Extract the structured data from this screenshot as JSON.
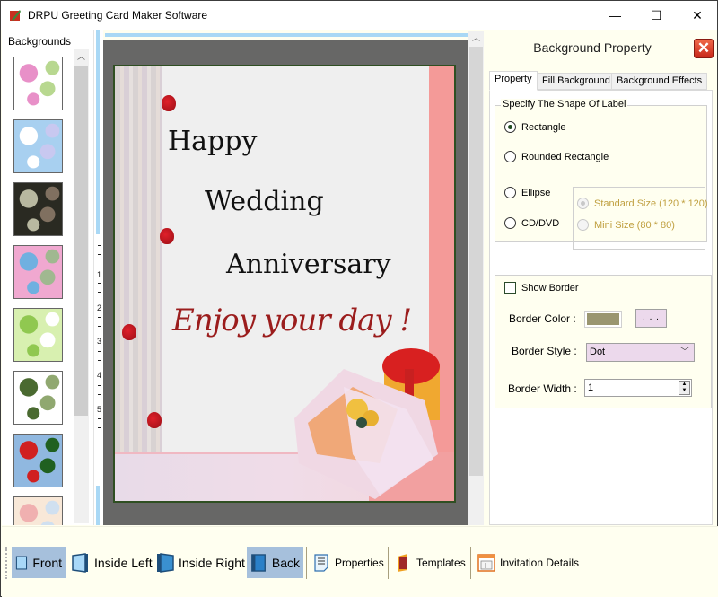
{
  "window": {
    "title": "DRPU Greeting Card Maker Software",
    "controls": {
      "minimize": "—",
      "maximize": "☐",
      "close": "✕"
    }
  },
  "left_panel": {
    "title": "Backgrounds",
    "thumbnails": [
      {
        "name": "baby-pattern",
        "colors": [
          "#ffffff",
          "#e890c8",
          "#b8d890"
        ]
      },
      {
        "name": "clouds",
        "colors": [
          "#a8d0f0",
          "#ffffff",
          "#c8c8f0"
        ]
      },
      {
        "name": "roses-dark",
        "colors": [
          "#2a2a22",
          "#b8b8a0",
          "#807060"
        ]
      },
      {
        "name": "flowers-pink-blue",
        "colors": [
          "#f0a8d0",
          "#70b0e0",
          "#a0b890"
        ]
      },
      {
        "name": "pine-trees",
        "colors": [
          "#d8f0b0",
          "#90c850",
          "#ffffff"
        ]
      },
      {
        "name": "holly-ornament",
        "colors": [
          "#ffffff",
          "#4a6a30",
          "#90a870"
        ]
      },
      {
        "name": "santa-pattern",
        "colors": [
          "#90b8e0",
          "#d02020",
          "#206020"
        ]
      },
      {
        "name": "stripes-pastel",
        "colors": [
          "#f8e8d8",
          "#f0b0b0",
          "#d0e0f0"
        ]
      }
    ]
  },
  "ruler": {
    "labels": [
      "1",
      "2",
      "3",
      "4",
      "5"
    ]
  },
  "card": {
    "line1": "Happy",
    "line2": "Wedding",
    "line3": "Anniversary",
    "script": "Enjoy your day !",
    "colors": {
      "text": "#111111",
      "script": "#9b1d1d",
      "right_stripe": "#f49a98",
      "frame": "#2f4f22"
    }
  },
  "right_panel": {
    "title": "Background Property",
    "close_label": "✕",
    "tabs": [
      {
        "label": "Property",
        "active": true
      },
      {
        "label": "Fill Background",
        "active": false
      },
      {
        "label": "Background Effects",
        "active": false
      }
    ],
    "shape_group": {
      "legend": "Specify The Shape Of Label",
      "options": [
        {
          "label": "Rectangle",
          "checked": true
        },
        {
          "label": "Rounded Rectangle",
          "checked": false
        },
        {
          "label": "Ellipse",
          "checked": false
        },
        {
          "label": "CD/DVD",
          "checked": false
        }
      ],
      "size_options": [
        {
          "label": "Standard Size (120 * 120)",
          "checked": true,
          "disabled": true
        },
        {
          "label": "Mini Size (80 * 80)",
          "checked": false,
          "disabled": true
        }
      ]
    },
    "border_group": {
      "show_border_label": "Show Border",
      "show_border_checked": false,
      "color_label": "Border Color :",
      "color_value": "#9a9670",
      "color_button_label": ". . .",
      "style_label": "Border Style :",
      "style_value": "Dot",
      "width_label": "Border Width :",
      "width_value": "1"
    }
  },
  "toolbar": {
    "buttons": [
      {
        "label": "Front",
        "active": true
      },
      {
        "label": "Inside Left",
        "active": false
      },
      {
        "label": "Inside Right",
        "active": false
      },
      {
        "label": "Back",
        "active": true
      },
      {
        "label": "Properties",
        "active": false
      },
      {
        "label": "Templates",
        "active": false
      },
      {
        "label": "Invitation Details",
        "active": false
      }
    ]
  }
}
